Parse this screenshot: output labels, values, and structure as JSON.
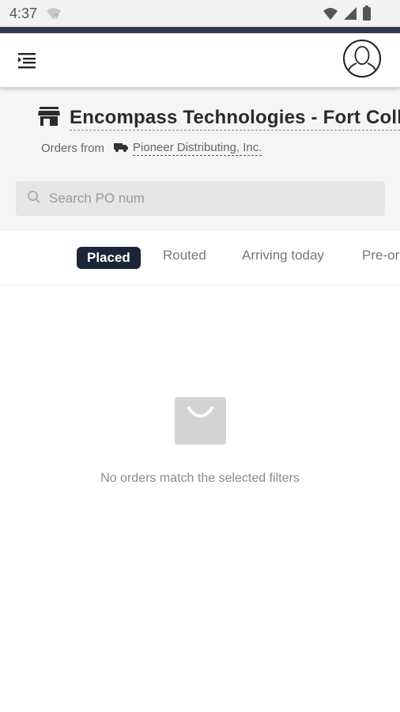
{
  "status_bar": {
    "time": "4:37",
    "left_icon": "wifi-question-icon",
    "right_icons": [
      "wifi-icon",
      "signal-icon",
      "battery-icon"
    ]
  },
  "app_bar": {
    "menu_icon": "menu-indent-icon",
    "profile_icon": "account-circle-icon"
  },
  "header": {
    "store_icon": "storefront-icon",
    "store_name": "Encompass Technologies - Fort Colli",
    "orders_from_label": "Orders from",
    "truck_icon": "truck-icon",
    "distributor": "Pioneer Distributing, Inc."
  },
  "search": {
    "placeholder": "Search PO num",
    "value": "",
    "icon": "search-icon"
  },
  "tabs": [
    {
      "label": "Placed",
      "active": true
    },
    {
      "label": "Routed",
      "active": false
    },
    {
      "label": "Arriving today",
      "active": false
    },
    {
      "label": "Pre-or",
      "active": false
    }
  ],
  "empty_state": {
    "icon": "shopping-bag-icon",
    "message": "No orders match the selected filters"
  },
  "colors": {
    "accent": "#1b2538",
    "top_line": "#2f3b52",
    "header_bg": "#f5f5f5",
    "search_bg": "#e6e6e6",
    "empty_icon": "#d3d3d3"
  }
}
